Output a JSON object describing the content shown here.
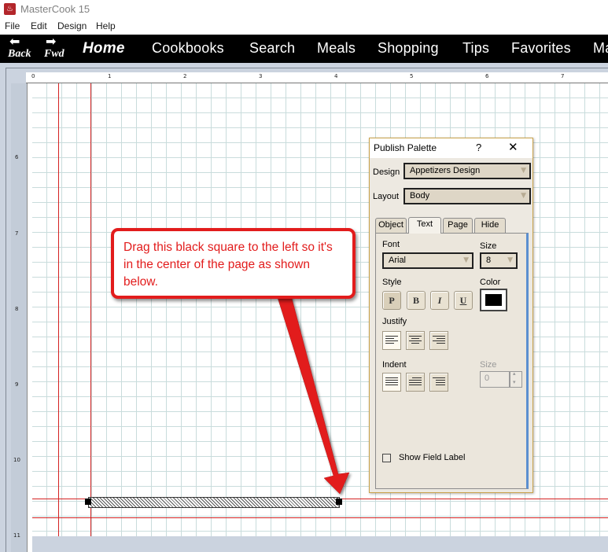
{
  "window": {
    "title": "MasterCook 15",
    "app_icon_glyph": "♨"
  },
  "menu": [
    "File",
    "Edit",
    "Design",
    "Help"
  ],
  "nav": {
    "back": "Back",
    "fwd": "Fwd",
    "items": [
      "Home",
      "Cookbooks",
      "Search",
      "Meals",
      "Shopping",
      "Tips",
      "Favorites",
      "Ma"
    ]
  },
  "ruler": {
    "horizontal": [
      "0",
      "1",
      "2",
      "3",
      "4",
      "5",
      "6",
      "7"
    ],
    "vertical": [
      "6",
      "7",
      "8",
      "9",
      "10",
      "11"
    ]
  },
  "callout": {
    "text": "Drag this black square to the left so it's in the center of the page as shown below."
  },
  "palette": {
    "title": "Publish Palette",
    "help": "?",
    "close": "✕",
    "design_label": "Design",
    "design_value": "Appetizers Design",
    "layout_label": "Layout",
    "layout_value": "Body",
    "tabs": [
      "Object",
      "Text",
      "Page",
      "Hide"
    ],
    "active_tab": "Text",
    "font_label": "Font",
    "font_value": "Arial",
    "size_label": "Size",
    "size_value": "8",
    "style_label": "Style",
    "style_buttons": [
      "P",
      "B",
      "I",
      "U"
    ],
    "color_label": "Color",
    "color_value": "#000000",
    "justify_label": "Justify",
    "indent_label": "Indent",
    "indent_size_label": "Size",
    "indent_size_value": "0",
    "show_field_label": "Show Field Label"
  },
  "colors": {
    "accent_red": "#e21c1c",
    "nav_bg": "#000000",
    "guide_red": "#d42222"
  }
}
